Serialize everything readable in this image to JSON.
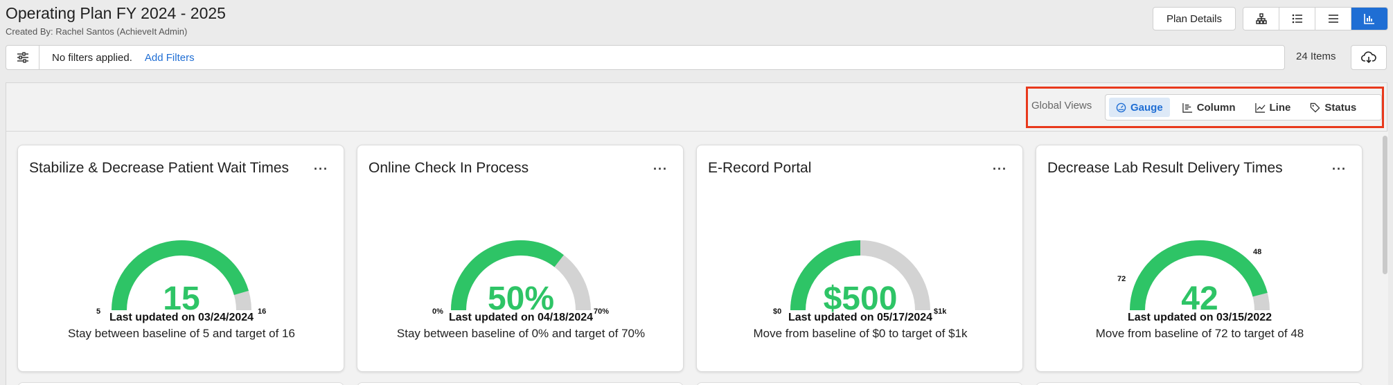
{
  "header": {
    "title": "Operating Plan FY 2024 - 2025",
    "subtitle": "Created By: Rachel Santos (AchieveIt Admin)",
    "plan_details_label": "Plan Details",
    "views": [
      {
        "icon": "hierarchy-icon"
      },
      {
        "icon": "bulleted-list-icon"
      },
      {
        "icon": "lines-icon"
      },
      {
        "icon": "chart-icon",
        "active": true
      }
    ]
  },
  "filters": {
    "status_text": "No filters applied.",
    "add_label": "Add Filters",
    "items_count": "24 Items"
  },
  "global_views": {
    "label": "Global Views",
    "options": [
      {
        "label": "Gauge",
        "icon": "gauge-icon",
        "active": true
      },
      {
        "label": "Column",
        "icon": "column-chart-icon"
      },
      {
        "label": "Line",
        "icon": "line-chart-icon"
      },
      {
        "label": "Status",
        "icon": "tag-icon"
      }
    ]
  },
  "cards": [
    {
      "title": "Stabilize & Decrease Patient Wait Times",
      "value": "15",
      "min_label": "5",
      "max_label": "16",
      "fill_fraction": 0.91,
      "updated": "Last updated on 03/24/2024",
      "description": "Stay between baseline of 5 and target of 16"
    },
    {
      "title": "Online Check In Process",
      "value": "50%",
      "min_label": "0%",
      "max_label": "70%",
      "fill_fraction": 0.71,
      "updated": "Last updated on 04/18/2024",
      "description": "Stay between baseline of 0% and target of 70%"
    },
    {
      "title": "E-Record Portal",
      "value": "$500",
      "min_label": "$0",
      "max_label": "$1k",
      "fill_fraction": 0.5,
      "updated": "Last updated on 05/17/2024",
      "description": "Move from baseline of $0 to target of $1k"
    },
    {
      "title": "Decrease Lab Result Delivery Times",
      "value": "42",
      "min_label": "",
      "max_label": "",
      "baseline_label": "72",
      "target_label": "48",
      "fill_fraction": 0.92,
      "updated": "Last updated on 03/15/2022",
      "description": "Move from baseline of 72 to target of 48"
    }
  ],
  "colors": {
    "gauge_fill": "#2ec466",
    "gauge_track": "#d3d3d3",
    "accent": "#1f6ed4",
    "highlight": "#e8391c"
  }
}
